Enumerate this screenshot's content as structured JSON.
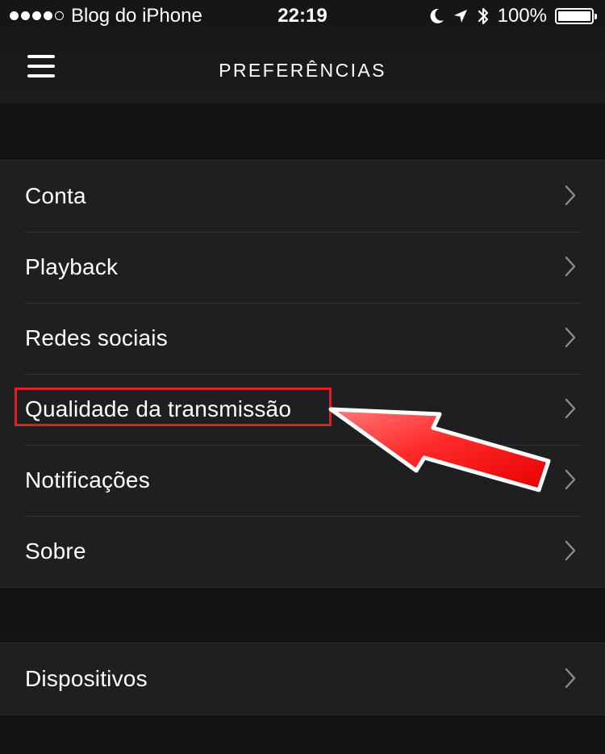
{
  "status_bar": {
    "carrier": "Blog do iPhone",
    "time": "22:19",
    "battery_percent": "100%",
    "signal_strength": 4,
    "signal_max": 5,
    "battery_level": 1.0,
    "icons": [
      "moon-icon",
      "location-arrow-icon",
      "bluetooth-icon",
      "battery-icon"
    ]
  },
  "header": {
    "title": "PREFERÊNCIAS",
    "menu_icon": "hamburger-menu-icon"
  },
  "settings": {
    "group1": [
      {
        "label": "Conta"
      },
      {
        "label": "Playback"
      },
      {
        "label": "Redes sociais"
      },
      {
        "label": "Qualidade da transmissão",
        "highlighted": true
      },
      {
        "label": "Notificações"
      },
      {
        "label": "Sobre"
      }
    ],
    "group2": [
      {
        "label": "Dispositivos"
      }
    ]
  },
  "annotation": {
    "highlight_color": "#e01f25",
    "arrow_color": "#ff1a1a",
    "highlighted_item": "Qualidade da transmissão"
  },
  "colors": {
    "background": "#121215",
    "row_background": "#1f1f22",
    "chevron": "#8c8c90",
    "text": "#ffffff"
  }
}
